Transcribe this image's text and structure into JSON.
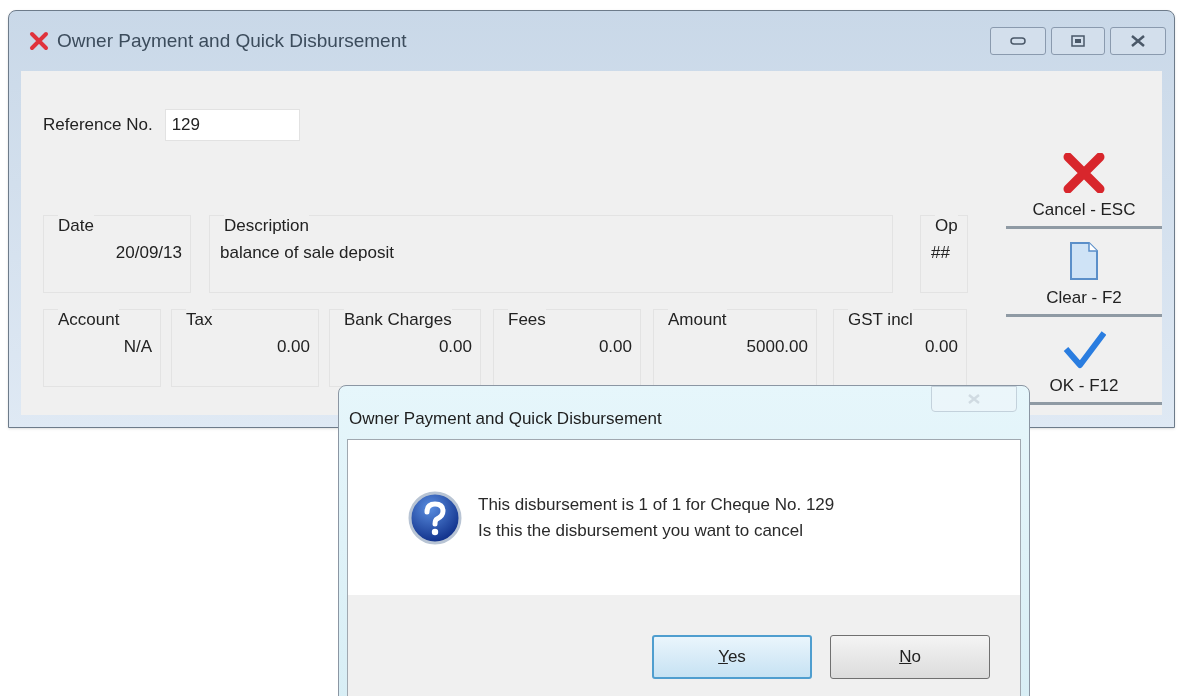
{
  "window": {
    "title": "Owner Payment and Quick Disbursement"
  },
  "reference": {
    "label": "Reference No.",
    "value": "129"
  },
  "fields_row_1": [
    {
      "label": "Date",
      "value": "20/09/13"
    },
    {
      "label": "Description",
      "value": "balance of sale deposit"
    },
    {
      "label": "Op",
      "value": "##"
    }
  ],
  "fields_row_2": [
    {
      "label": "Account",
      "value": "N/A"
    },
    {
      "label": "Tax",
      "value": "0.00"
    },
    {
      "label": "Bank Charges",
      "value": "0.00"
    },
    {
      "label": "Fees",
      "value": "0.00"
    },
    {
      "label": "Amount",
      "value": "5000.00"
    },
    {
      "label": "GST incl",
      "value": "0.00"
    }
  ],
  "toolbar": [
    {
      "kind": "cancel",
      "label": "Cancel - ESC"
    },
    {
      "kind": "clear",
      "label": "Clear - F2"
    },
    {
      "kind": "ok",
      "label": "OK - F12"
    }
  ],
  "dialog": {
    "title": "Owner Payment and Quick Disbursement",
    "close_disabled": true,
    "message": [
      "This disbursement is 1 of 1 for Cheque No. 129",
      "Is this the disbursement you want to cancel"
    ],
    "buttons": [
      {
        "label": "Yes",
        "default": true
      },
      {
        "label": "No",
        "default": false
      }
    ]
  }
}
